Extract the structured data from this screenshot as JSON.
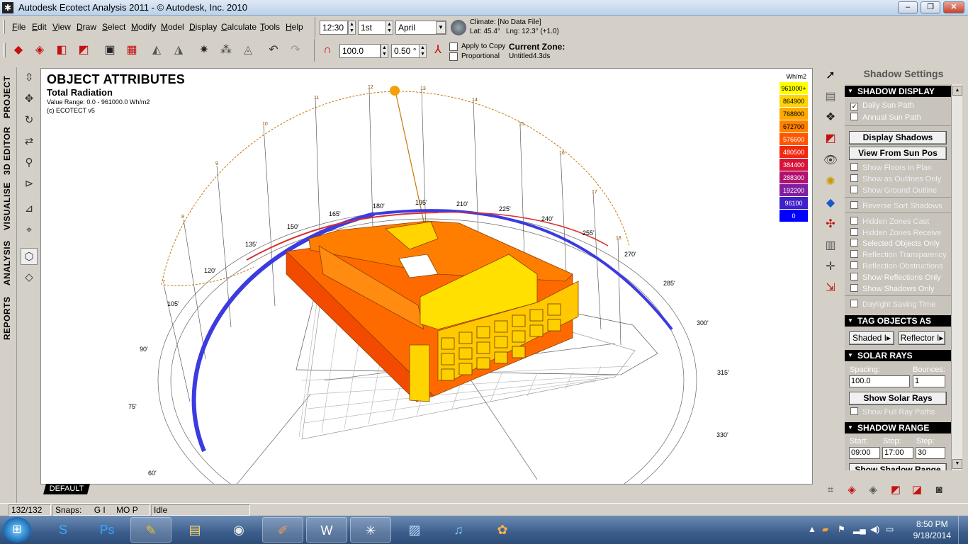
{
  "window": {
    "title": "Autodesk Ecotect Analysis 2011 - © Autodesk, Inc. 2010",
    "min": "–",
    "max": "❐",
    "close": "✕"
  },
  "menu": [
    "File",
    "Edit",
    "View",
    "Draw",
    "Select",
    "Modify",
    "Model",
    "Display",
    "Calculate",
    "Tools",
    "Help"
  ],
  "toolbar": {
    "time": "12:30",
    "day": "1st",
    "month": "April",
    "climate": "Climate: [No Data File]",
    "lat": "Lat: 45.4°",
    "lng": "Lng: 12.3° (+1.0)",
    "zoom": "100.0",
    "increment": "0.50 °",
    "apply_to_copy": "Apply to Copy",
    "proportional": "Proportional",
    "current_zone_label": "Current Zone:",
    "current_zone_value": "Untitled4.3ds"
  },
  "side_tabs": [
    "PROJECT",
    "3D EDITOR",
    "VISUALISE",
    "ANALYSIS",
    "REPORTS"
  ],
  "viewport": {
    "title": "OBJECT ATTRIBUTES",
    "subtitle": "Total Radiation",
    "value_range": "Value Range: 0.0 - 961000.0 Wh/m2",
    "copyright": "(c) ECOTECT v5",
    "legend_unit": "Wh/m2",
    "legend": [
      {
        "label": "961000+",
        "color": "#ffff00"
      },
      {
        "label": "864900",
        "color": "#ffd400"
      },
      {
        "label": "768800",
        "color": "#ffaa00"
      },
      {
        "label": "672700",
        "color": "#ff8000"
      },
      {
        "label": "576600",
        "color": "#ff5500"
      },
      {
        "label": "480500",
        "color": "#f02a10"
      },
      {
        "label": "384400",
        "color": "#d8123a"
      },
      {
        "label": "288300",
        "color": "#b01070"
      },
      {
        "label": "192200",
        "color": "#8020a0"
      },
      {
        "label": "96100",
        "color": "#4020c8"
      },
      {
        "label": "0",
        "color": "#0000ff"
      }
    ],
    "compass_labels": [
      "60'",
      "75'",
      "90'",
      "105'",
      "120'",
      "135'",
      "150'",
      "165'",
      "180'",
      "195'",
      "210'",
      "225'",
      "240'",
      "255'",
      "270'",
      "285'",
      "300'",
      "315'",
      "330'"
    ],
    "hour_labels": [
      "7",
      "8",
      "9",
      "10",
      "11",
      "12",
      "13",
      "14",
      "15",
      "16",
      "17",
      "18"
    ],
    "tab": "DEFAULT"
  },
  "panel": {
    "title": "Shadow Settings",
    "sections": {
      "shadow_display": "SHADOW DISPLAY",
      "tag_objects": "TAG OBJECTS AS",
      "solar_rays": "SOLAR RAYS",
      "shadow_range": "SHADOW RANGE"
    },
    "daily_sun_path": "Daily Sun Path",
    "annual_sun_path": "Annual Sun Path",
    "display_shadows": "Display Shadows",
    "view_from_sun": "View From Sun Pos",
    "show_floors_in_plan": "Show Floors in Plan",
    "show_as_outlines": "Show as Outlines Only",
    "show_ground_outline": "Show Ground Outline",
    "reverse_sort": "Reverse Sort Shadows",
    "hidden_zones_cast": "Hidden Zones Cast",
    "hidden_zones_receive": "Hidden Zones Receive",
    "selected_objects_only": "Selected Objects Only",
    "reflection_transparency": "Reflection Transparency",
    "reflection_obstructions": "Reflection Obstructions",
    "show_reflections_only": "Show Reflections Only",
    "show_shadows_only": "Show Shadows Only",
    "daylight_saving": "Daylight Saving Time",
    "shaded_btn": "Shaded I▸",
    "reflector_btn": "Reflector I▸",
    "spacing_label": "Spacing:",
    "bounces_label": "Bounces:",
    "spacing_value": "100.0",
    "bounces_value": "1",
    "show_solar_rays": "Show Solar Rays",
    "show_full_ray_paths": "Show Full Ray Paths",
    "start_label": "Start:",
    "stop_label": "Stop:",
    "step_label": "Step:",
    "start_value": "09:00",
    "stop_value": "17:00",
    "step_value": "30",
    "show_shadow_range": "Show Shadow Range"
  },
  "status": {
    "count": "132/132",
    "snaps_label": "Snaps:",
    "snaps_gi": "G I",
    "snaps_mop": "MO P",
    "state": "Idle"
  },
  "taskbar": {
    "time": "8:50 PM",
    "date": "9/18/2014"
  }
}
